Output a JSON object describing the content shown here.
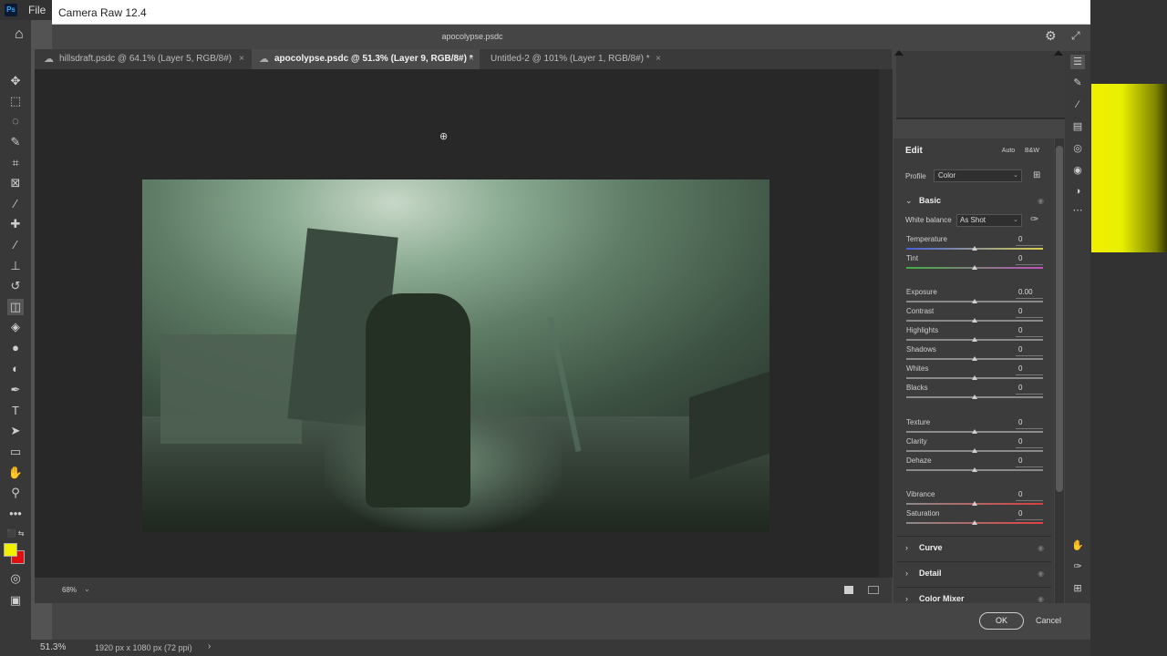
{
  "photoshop": {
    "logo": "Ps",
    "menu_file": "File",
    "status_zoom": "51.3%",
    "status_doc": "1920 px x 1080 px (72 ppi)",
    "status_arrow": "›"
  },
  "dialog": {
    "title": "Camera Raw 12.4",
    "filename": "apocolypse.psdc"
  },
  "tabs": [
    {
      "label": "hillsdraft.psdc @ 64.1% (Layer 5, RGB/8#)"
    },
    {
      "label": "apocolypse.psdc @ 51.3% (Layer 9, RGB/8#) *"
    },
    {
      "label": "Untitled-2 @ 101% (Layer 1, RGB/8#) *"
    }
  ],
  "canvas": {
    "zoom": "68%"
  },
  "edit": {
    "heading": "Edit",
    "auto_label": "Auto",
    "bw_label": "B&W",
    "profile_label": "Profile",
    "profile_value": "Color",
    "basic": {
      "title": "Basic",
      "wb_label": "White balance",
      "wb_value": "As Shot",
      "sliders": [
        {
          "label": "Temperature",
          "value": "0",
          "position": 0.5
        },
        {
          "label": "Tint",
          "value": "0",
          "position": 0.5
        },
        {
          "label": "Exposure",
          "value": "0.00",
          "position": 0.5
        },
        {
          "label": "Contrast",
          "value": "0",
          "position": 0.5
        },
        {
          "label": "Highlights",
          "value": "0",
          "position": 0.5
        },
        {
          "label": "Shadows",
          "value": "0",
          "position": 0.5
        },
        {
          "label": "Whites",
          "value": "0",
          "position": 0.5
        },
        {
          "label": "Blacks",
          "value": "0",
          "position": 0.5
        },
        {
          "label": "Texture",
          "value": "0",
          "position": 0.5
        },
        {
          "label": "Clarity",
          "value": "0",
          "position": 0.5
        },
        {
          "label": "Dehaze",
          "value": "0",
          "position": 0.5
        },
        {
          "label": "Vibrance",
          "value": "0",
          "position": 0.5
        },
        {
          "label": "Saturation",
          "value": "0",
          "position": 0.5
        }
      ]
    },
    "sections": [
      {
        "title": "Curve"
      },
      {
        "title": "Detail"
      },
      {
        "title": "Color Mixer"
      }
    ]
  },
  "buttons": {
    "ok": "OK",
    "cancel": "Cancel"
  },
  "colors": {
    "foreground": "#f0f000",
    "background": "#e01010"
  }
}
